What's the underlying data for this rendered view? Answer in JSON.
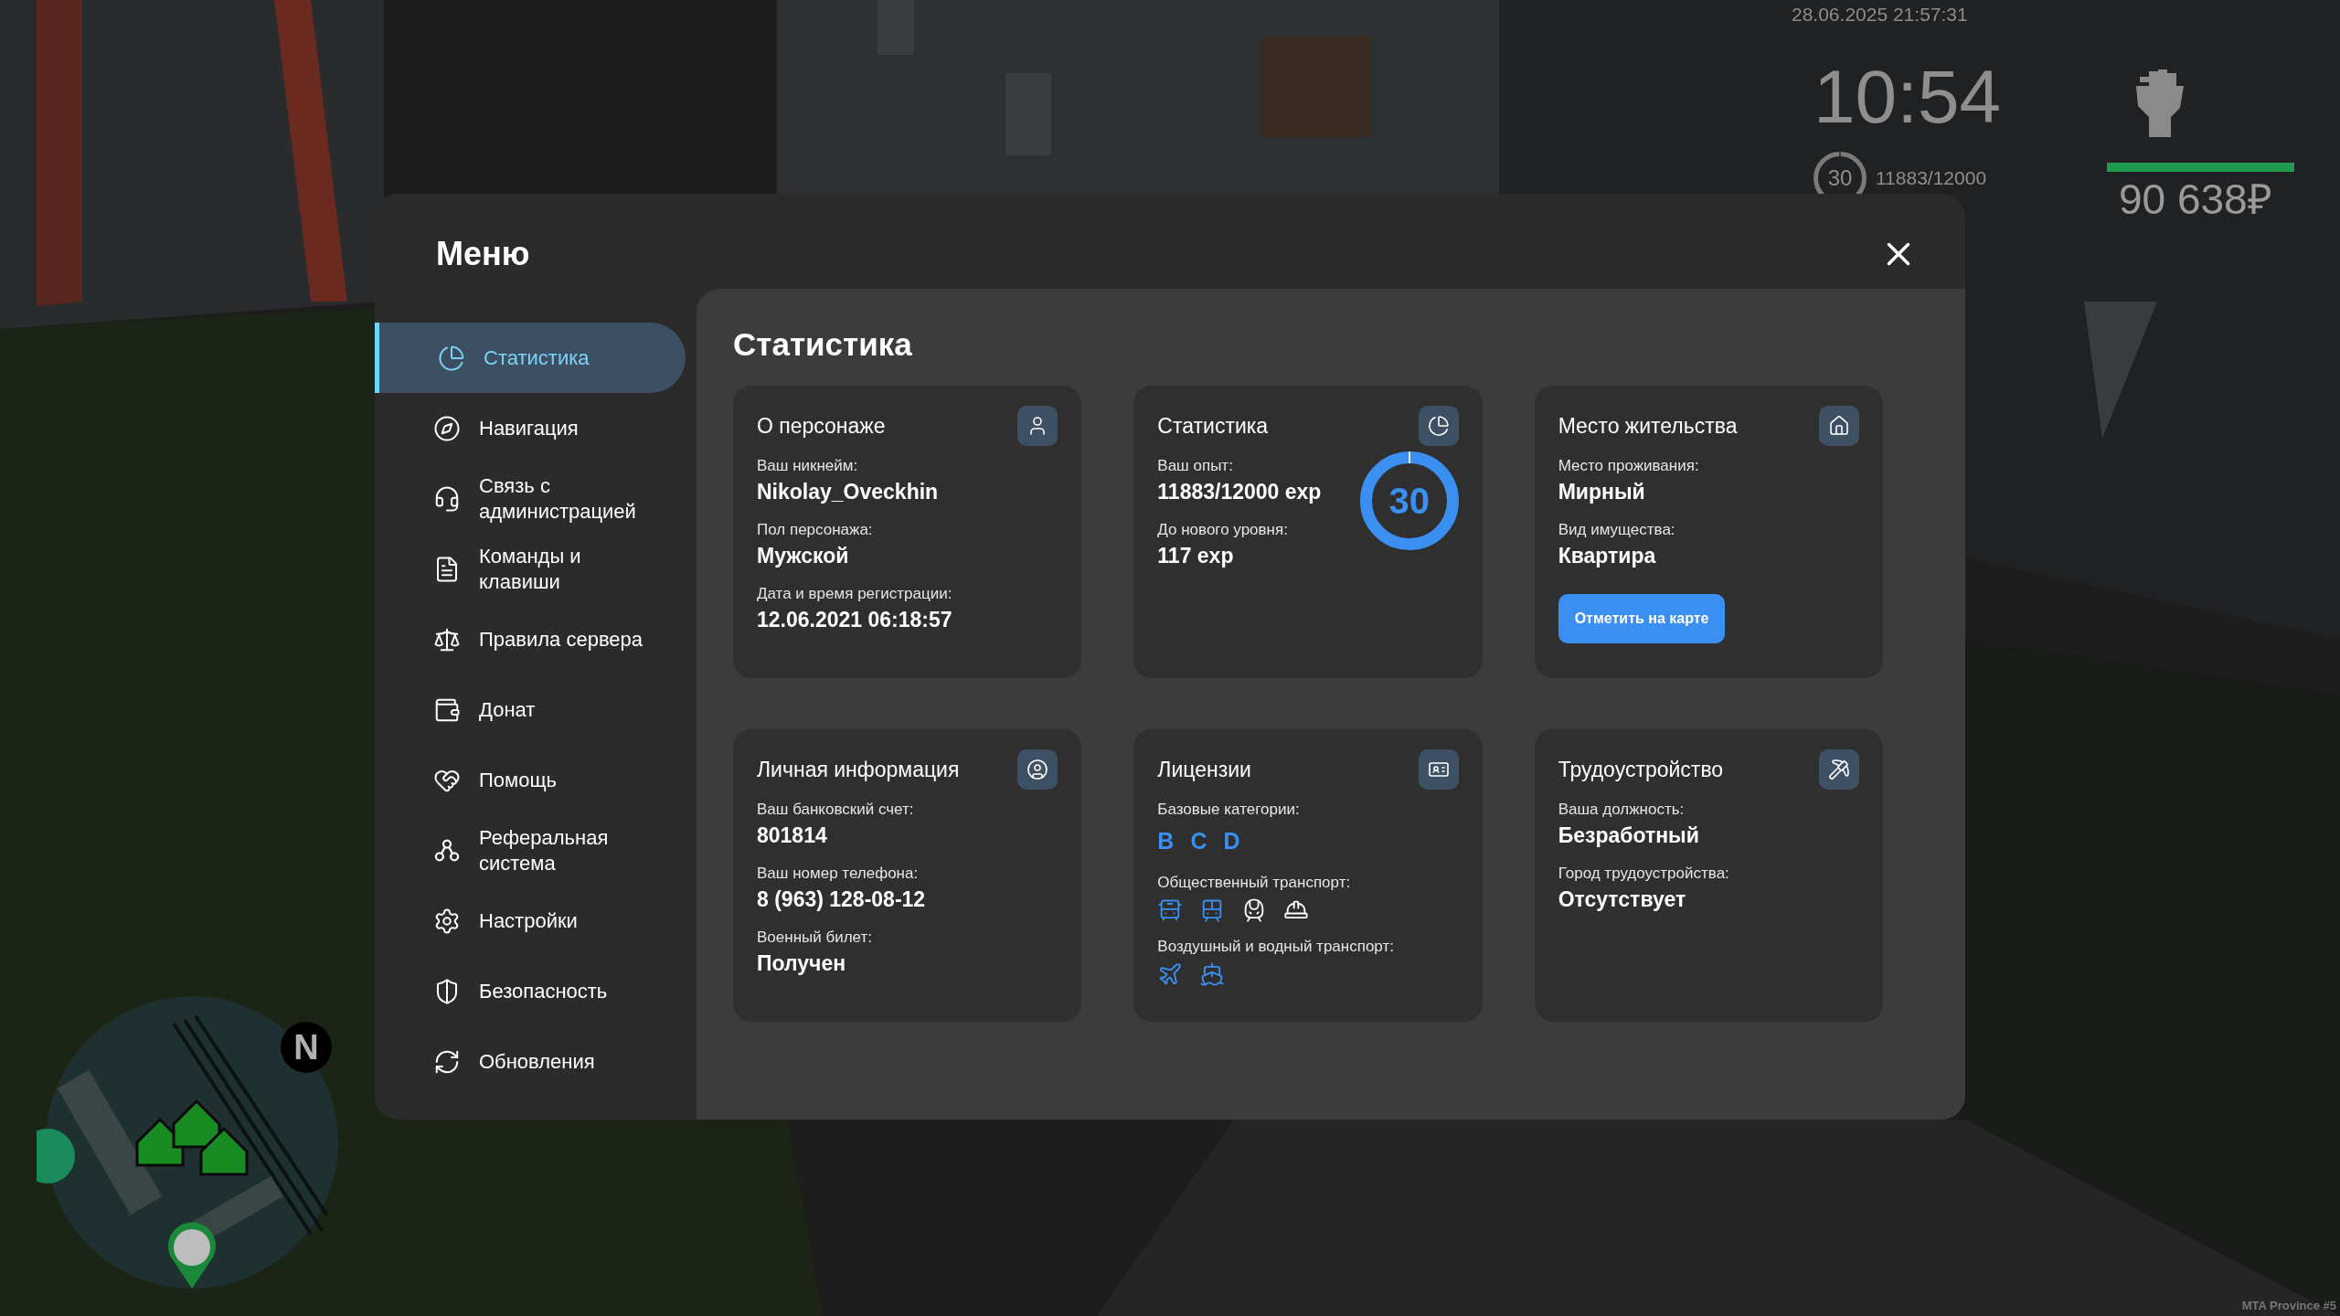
{
  "hud": {
    "datetime": "28.06.2025 21:57:31",
    "time": "10:54",
    "rank_ring": {
      "label": "30"
    },
    "exp": "11883/12000",
    "money": "90 638₽"
  },
  "minimap": {
    "north": "N"
  },
  "server_label": "MTA Province #5",
  "menu": {
    "title": "Меню",
    "items": [
      {
        "label": "Статистика",
        "selected": true
      },
      {
        "label": "Навигация",
        "selected": false
      },
      {
        "label": "Связь с администрацией",
        "selected": false
      },
      {
        "label": "Команды и клавиши",
        "selected": false
      },
      {
        "label": "Правила сервера",
        "selected": false
      },
      {
        "label": "Донат",
        "selected": false
      },
      {
        "label": "Помощь",
        "selected": false
      },
      {
        "label": "Реферальная система",
        "selected": false
      },
      {
        "label": "Настройки",
        "selected": false
      },
      {
        "label": "Безопасность",
        "selected": false
      },
      {
        "label": "Обновления",
        "selected": false
      }
    ]
  },
  "content": {
    "title": "Статистика",
    "cards": [
      {
        "kind": "info",
        "title": "О персонаже",
        "fields": [
          {
            "label": "Ваш никнейм:",
            "value": "Nikolay_Oveckhin"
          },
          {
            "label": "Пол персонажа:",
            "value": "Мужской"
          },
          {
            "label": "Дата и время регистрации:",
            "value": "12.06.2021 06:18:57"
          }
        ]
      },
      {
        "kind": "stats",
        "title": "Статистика",
        "fields": [
          {
            "label": "Ваш опыт:",
            "value": "11883/12000 exp"
          },
          {
            "label": "До нового уровня:",
            "value": "117 exp"
          }
        ],
        "ring": {
          "label": "30"
        }
      },
      {
        "kind": "home",
        "title": "Место жительства",
        "fields": [
          {
            "label": "Место проживания:",
            "value": "Мирный"
          },
          {
            "label": "Вид имущества:",
            "value": "Квартира"
          }
        ],
        "button": "Отметить на карте"
      },
      {
        "kind": "info",
        "title": "Личная информация",
        "fields": [
          {
            "label": "Ваш банковский счет:",
            "value": "801814"
          },
          {
            "label": "Ваш номер телефона:",
            "value": "8 (963) 128-08-12"
          },
          {
            "label": "Военный билет:",
            "value": "Получен"
          }
        ]
      },
      {
        "kind": "licenses",
        "title": "Лицензии",
        "groups": [
          {
            "kind": "letters",
            "label": "Базовые категории:",
            "items": [
              {
                "text": "B",
                "owned": true
              },
              {
                "text": "C",
                "owned": true
              },
              {
                "text": "D",
                "owned": true
              }
            ]
          },
          {
            "kind": "icons",
            "label": "Общественный транспорт:",
            "items": [
              {
                "owned": true
              },
              {
                "owned": true
              },
              {
                "owned": false
              },
              {
                "owned": false
              }
            ]
          },
          {
            "kind": "icons",
            "label": "Воздушный и водный транспорт:",
            "items": [
              {
                "owned": true
              },
              {
                "owned": true
              }
            ]
          }
        ]
      },
      {
        "kind": "info",
        "title": "Трудоустройство",
        "fields": [
          {
            "label": "Ваша должность:",
            "value": "Безработный"
          },
          {
            "label": "Город трудоустройства:",
            "value": "Отсутствует"
          }
        ]
      }
    ]
  }
}
